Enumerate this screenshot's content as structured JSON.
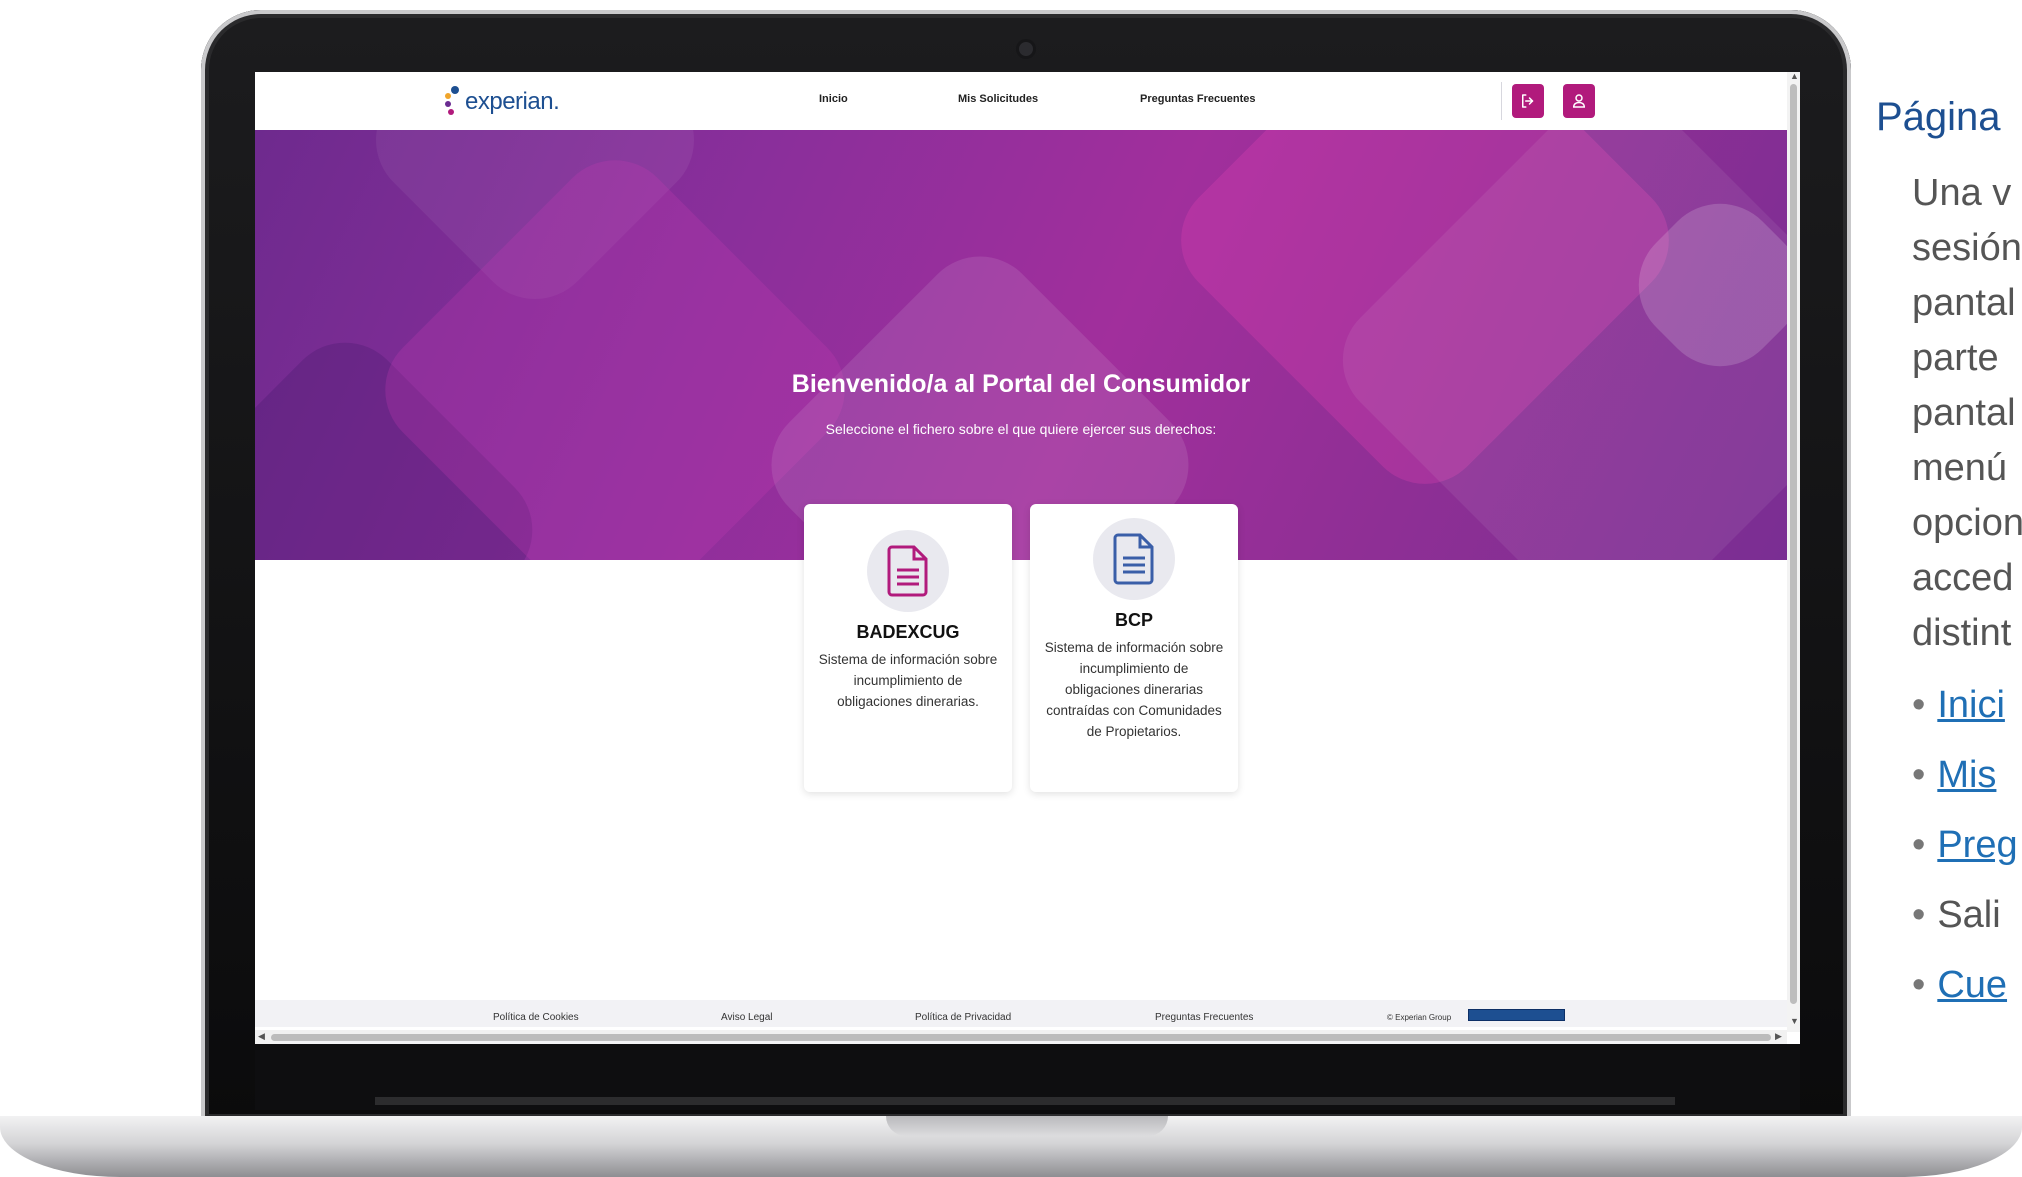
{
  "brand": {
    "logo_text": "experian."
  },
  "nav": {
    "inicio": "Inicio",
    "mis_solicitudes": "Mis Solicitudes",
    "preguntas": "Preguntas Frecuentes"
  },
  "hero": {
    "title": "Bienvenido/a al Portal del Consumidor",
    "subtitle": "Seleccione el fichero sobre el que quiere ejercer sus derechos:"
  },
  "cards": [
    {
      "title": "BADEXCUG",
      "desc": "Sistema de información sobre incumplimiento de obligaciones dinerarias.",
      "icon": "document-icon",
      "color": "#b11a7c"
    },
    {
      "title": "BCP",
      "desc": "Sistema de información sobre incumplimiento de obligaciones dinerarias contraídas con Comunidades de Propietarios.",
      "icon": "document-icon",
      "color": "#3a5ea8"
    }
  ],
  "footer": {
    "cookies": "Política de Cookies",
    "legal": "Aviso Legal",
    "privacy": "Política de Privacidad",
    "faq": "Preguntas Frecuentes",
    "copyright": "© Experian Group"
  },
  "side": {
    "title": "Página",
    "lines": [
      "Una v",
      "sesión",
      "pantal",
      "parte",
      "pantal",
      "menú",
      "opcion",
      "acced",
      "distint"
    ],
    "bullets": [
      {
        "text": "Inici",
        "link": true
      },
      {
        "text": "Mis",
        "link": true
      },
      {
        "text": "Preg",
        "link": true
      },
      {
        "text": "Sali",
        "link": false
      },
      {
        "text": "Cue",
        "link": true
      }
    ]
  },
  "colors": {
    "brand_magenta": "#b11a7c",
    "brand_blue": "#1d4f91",
    "hero_purple": "#8a2f9b"
  }
}
